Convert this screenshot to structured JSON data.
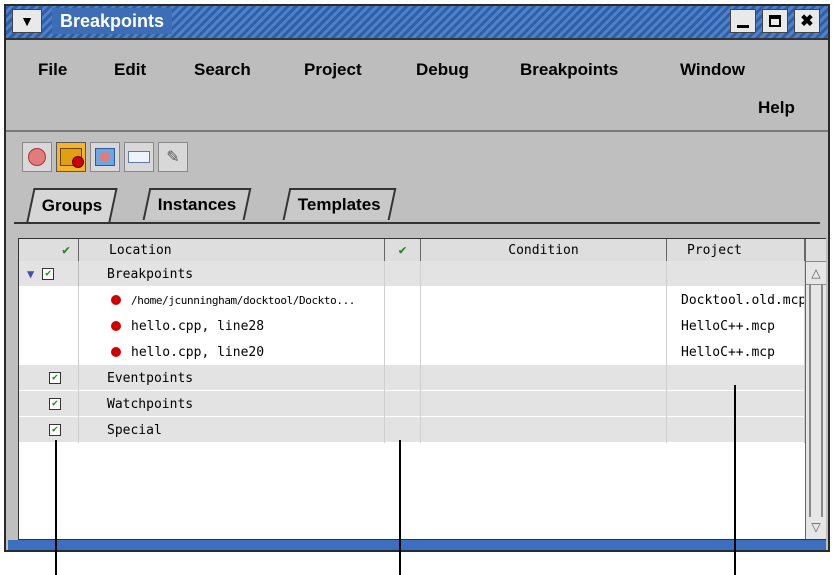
{
  "window": {
    "title": "Breakpoints"
  },
  "menu": {
    "items": [
      "File",
      "Edit",
      "Search",
      "Project",
      "Debug",
      "Breakpoints",
      "Window",
      "Help"
    ]
  },
  "tabs": [
    "Groups",
    "Instances",
    "Templates"
  ],
  "table": {
    "headers": {
      "enabled": "✔",
      "location": "Location",
      "condition_enabled": "✔",
      "condition": "Condition",
      "project": "Project"
    },
    "rows": [
      {
        "location": "Breakpoints",
        "project": "",
        "group": true
      },
      {
        "location": "/home/jcunningham/docktool/Dockto...",
        "project": "Docktool.old.mcp",
        "group": false
      },
      {
        "location": "hello.cpp, line28",
        "project": "HelloC++.mcp",
        "group": false
      },
      {
        "location": "hello.cpp, line20",
        "project": "HelloC++.mcp",
        "group": false
      },
      {
        "location": "Eventpoints",
        "project": "",
        "group": true
      },
      {
        "location": "Watchpoints",
        "project": "",
        "group": true
      },
      {
        "location": "Special",
        "project": "",
        "group": true
      }
    ]
  },
  "colors": {
    "titlebar": "#3d6db5",
    "active_toolbar_button": "#f3b52a",
    "breakpoint_dot": "#d10000",
    "checkmark": "#1a8a1a"
  }
}
